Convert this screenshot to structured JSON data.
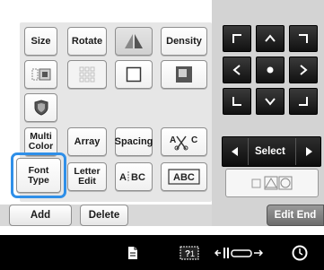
{
  "toolbar_row1": {
    "size": "Size",
    "rotate": "Rotate",
    "density": "Density"
  },
  "toolbar_row4": {
    "multi_color": "Multi Color",
    "array": "Array",
    "spacing": "Spacing"
  },
  "toolbar_row5": {
    "font_type": "Font Type",
    "letter_edit": "Letter Edit"
  },
  "select": {
    "label": "Select"
  },
  "actions": {
    "add": "Add",
    "delete": "Delete",
    "edit_end": "Edit End"
  },
  "colors": {
    "selection_ring": "#2f8fe8",
    "panel_gray": "#d3d3d3",
    "status_bar": "#000000"
  },
  "icons": {
    "mirror": "mirror-icon",
    "border": "border-icon",
    "array_grid": "array-grid-icon",
    "white_square": "white-square-icon",
    "shadow_square": "shadow-square-icon",
    "shield_crest": "shield-crest-icon",
    "letter_spacing": "letter-spacing-icon",
    "text_layout": "text-layout-icon",
    "text_frame": "text-frame-icon",
    "move_arrows": [
      "corner-up-left-icon",
      "arrow-up-icon",
      "corner-up-right-icon",
      "arrow-left-icon",
      "center-dot-icon",
      "arrow-right-icon",
      "corner-down-left-icon",
      "arrow-down-icon",
      "corner-down-right-icon"
    ],
    "status": [
      "file-icon",
      "stitch-preview-icon",
      "frame-move-icon",
      "clock-icon"
    ]
  }
}
